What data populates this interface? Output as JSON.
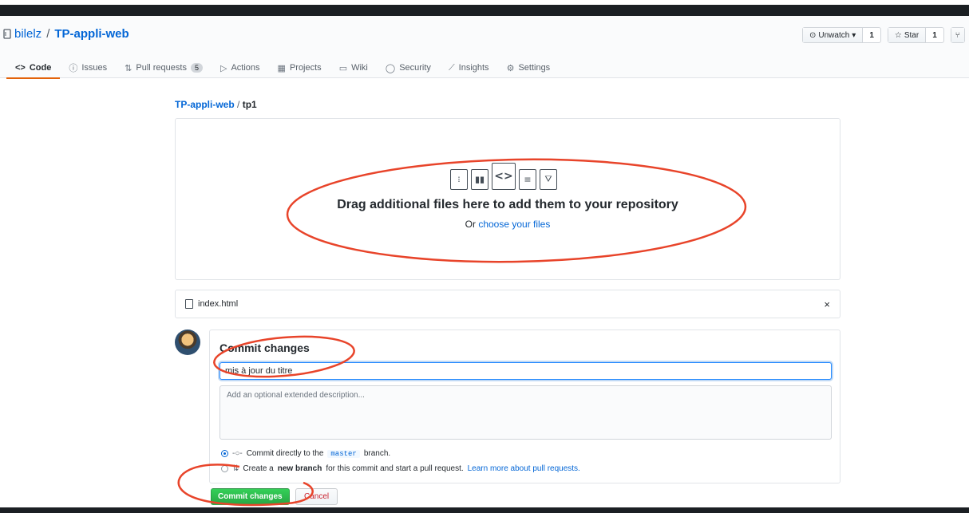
{
  "repo": {
    "owner": "bilelz",
    "separator": "/",
    "name": "TP-appli-web"
  },
  "actions": {
    "watch_label": "Unwatch",
    "watch_count": "1",
    "star_label": "Star",
    "star_count": "1"
  },
  "tabs": [
    {
      "label": "Code",
      "icon": "code-icon"
    },
    {
      "label": "Issues",
      "icon": "issue-icon"
    },
    {
      "label": "Pull requests",
      "icon": "pull-request-icon",
      "badge": "5"
    },
    {
      "label": "Actions",
      "icon": "play-icon"
    },
    {
      "label": "Projects",
      "icon": "project-icon"
    },
    {
      "label": "Wiki",
      "icon": "book-icon"
    },
    {
      "label": "Security",
      "icon": "shield-icon"
    },
    {
      "label": "Insights",
      "icon": "graph-icon"
    },
    {
      "label": "Settings",
      "icon": "gear-icon"
    }
  ],
  "breadcrumb": {
    "repo": "TP-appli-web",
    "separator": "/",
    "path": "tp1"
  },
  "dropzone": {
    "title": "Drag additional files here to add them to your repository",
    "prefix": "Or",
    "link": "choose your files"
  },
  "file": {
    "name": "index.html",
    "remove": "×"
  },
  "commit": {
    "title": "Commit changes",
    "summary_value": "mis à jour du titre",
    "description_placeholder": "Add an optional extended description...",
    "option_direct_prefix": "Commit directly to the",
    "option_direct_branch": "master",
    "option_direct_suffix": "branch.",
    "option_new_prefix": "Create a",
    "option_new_bold": "new branch",
    "option_new_suffix": "for this commit and start a pull request.",
    "option_new_link": "Learn more about pull requests.",
    "submit_label": "Commit changes",
    "cancel_label": "Cancel"
  },
  "colors": {
    "link": "#0366d6",
    "primary_button": "#28a745",
    "active_tab_underline": "#e36209",
    "annotation": "#e8442a"
  }
}
